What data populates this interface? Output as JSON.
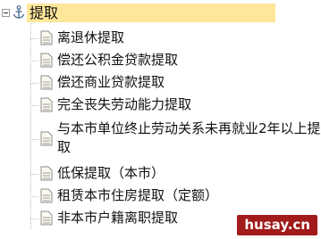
{
  "tree": {
    "root": {
      "label": "提取",
      "icon": "anchor-icon",
      "state": "expanded",
      "highlight_color": "#ffe79a"
    },
    "items": [
      {
        "label": "离退休提取",
        "icon": "document-icon"
      },
      {
        "label": "偿还公积金贷款提取",
        "icon": "document-icon"
      },
      {
        "label": "偿还商业贷款提取",
        "icon": "document-icon"
      },
      {
        "label": "完全丧失劳动能力提取",
        "icon": "document-icon"
      },
      {
        "label": "与本市单位终止劳动关系未再就业2年以上提取",
        "icon": "document-icon"
      },
      {
        "label": "低保提取（本市）",
        "icon": "document-icon"
      },
      {
        "label": "租赁本市住房提取（定额）",
        "icon": "document-icon"
      },
      {
        "label": "非本市户籍离职提取",
        "icon": "document-icon"
      }
    ]
  },
  "watermark": {
    "text": "husay.cn",
    "background": "#a11b1b"
  }
}
